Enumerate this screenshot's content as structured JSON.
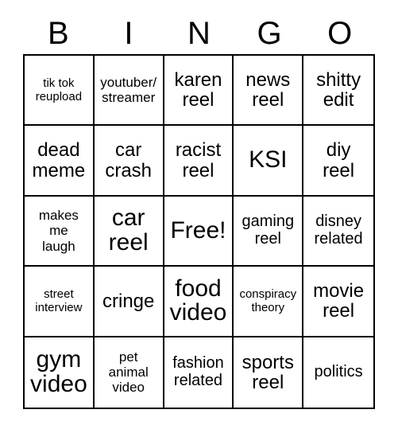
{
  "card": {
    "type": "bingo-card",
    "columns": 5,
    "rows": 5,
    "background_color": "#ffffff",
    "text_color": "#000000",
    "border_color": "#000000"
  },
  "header": {
    "letters": [
      "B",
      "I",
      "N",
      "G",
      "O"
    ]
  },
  "grid": {
    "free_space_index": 12,
    "cells": [
      {
        "text": "tik tok\nreupload",
        "size": "xs",
        "free": false
      },
      {
        "text": "youtuber/\nstreamer",
        "size": "sm",
        "free": false
      },
      {
        "text": "karen\nreel",
        "size": "lg",
        "free": false
      },
      {
        "text": "news\nreel",
        "size": "lg",
        "free": false
      },
      {
        "text": "shitty\nedit",
        "size": "lg",
        "free": false
      },
      {
        "text": "dead\nmeme",
        "size": "lg",
        "free": false
      },
      {
        "text": "car\ncrash",
        "size": "lg",
        "free": false
      },
      {
        "text": "racist\nreel",
        "size": "lg",
        "free": false
      },
      {
        "text": "KSI",
        "size": "xl",
        "free": false
      },
      {
        "text": "diy\nreel",
        "size": "lg",
        "free": false
      },
      {
        "text": "makes\nme\nlaugh",
        "size": "sm",
        "free": false
      },
      {
        "text": "car\nreel",
        "size": "xl",
        "free": false
      },
      {
        "text": "Free!",
        "size": "xl",
        "free": true
      },
      {
        "text": "gaming\nreel",
        "size": "md",
        "free": false
      },
      {
        "text": "disney\nrelated",
        "size": "md",
        "free": false
      },
      {
        "text": "street\ninterview",
        "size": "xs",
        "free": false
      },
      {
        "text": "cringe",
        "size": "lg",
        "free": false
      },
      {
        "text": "food\nvideo",
        "size": "xl",
        "free": false
      },
      {
        "text": "conspiracy\ntheory",
        "size": "xs",
        "free": false
      },
      {
        "text": "movie\nreel",
        "size": "lg",
        "free": false
      },
      {
        "text": "gym\nvideo",
        "size": "xl",
        "free": false
      },
      {
        "text": "pet\nanimal\nvideo",
        "size": "sm",
        "free": false
      },
      {
        "text": "fashion\nrelated",
        "size": "md",
        "free": false
      },
      {
        "text": "sports\nreel",
        "size": "lg",
        "free": false
      },
      {
        "text": "politics",
        "size": "md",
        "free": false
      }
    ]
  }
}
